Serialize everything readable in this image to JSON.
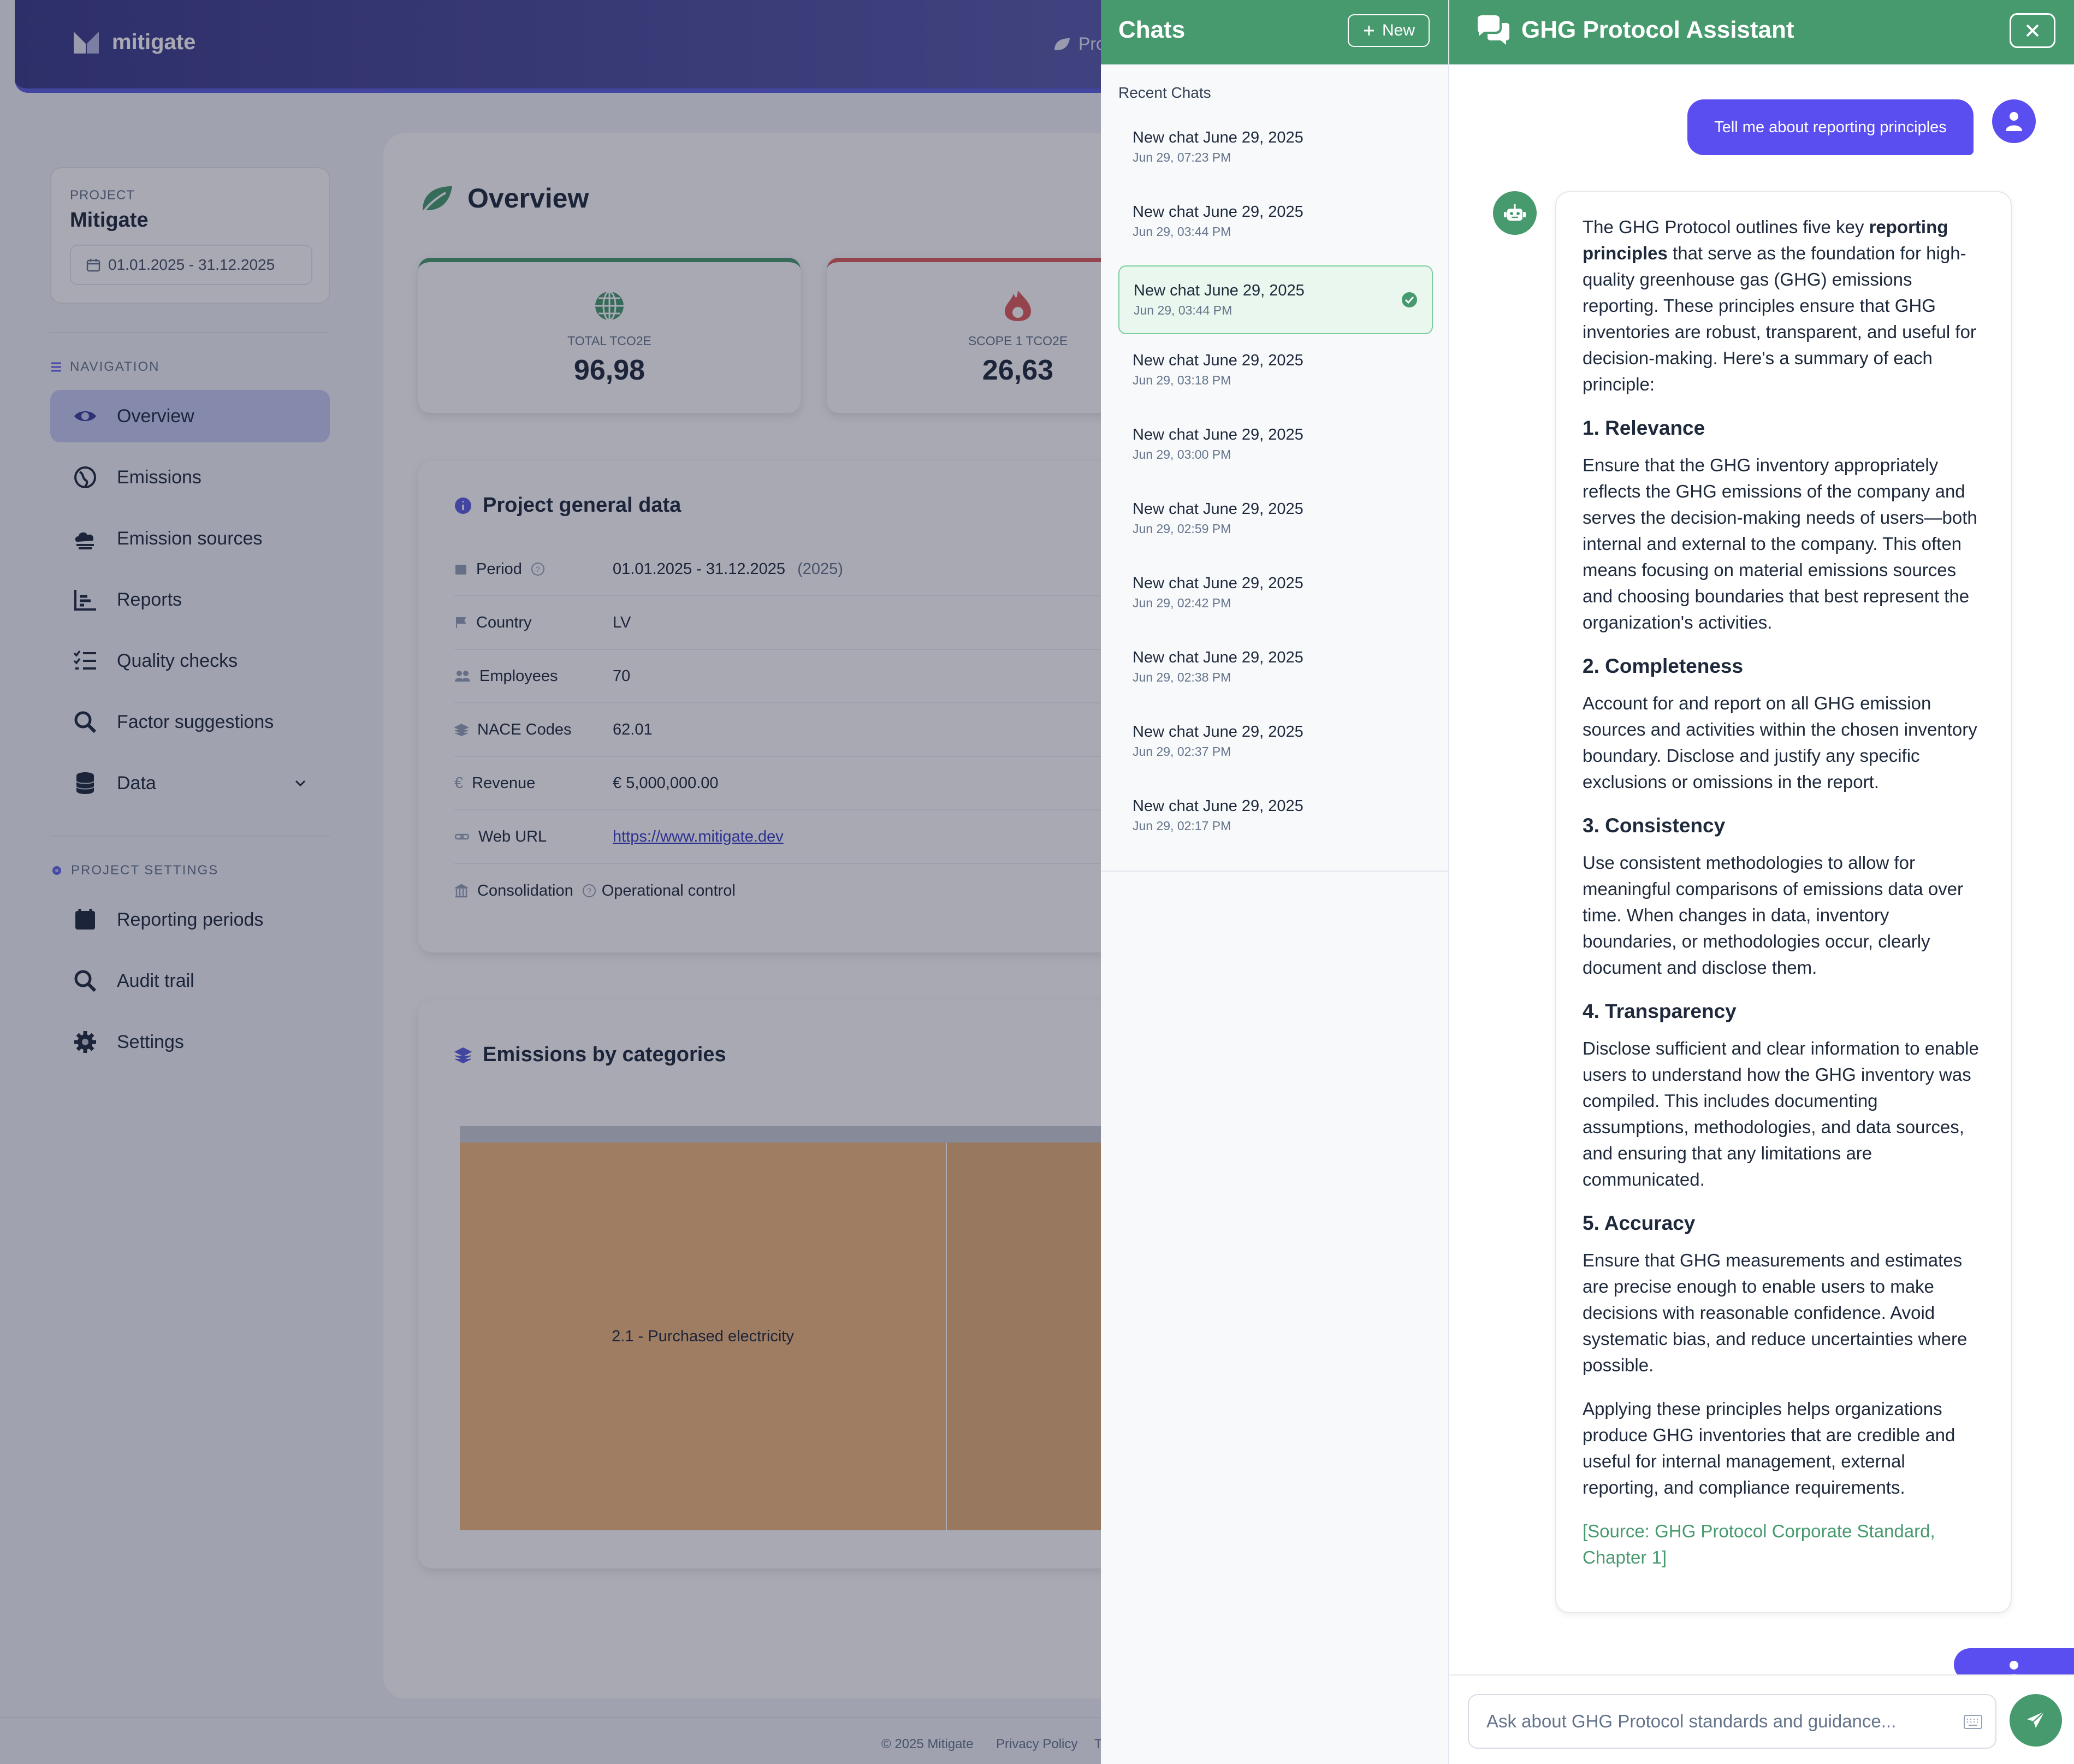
{
  "app": {
    "brand": "mitigate",
    "projects_link": "Proje"
  },
  "sidebar": {
    "project_label": "PROJECT",
    "project_name": "Mitigate",
    "project_period": "01.01.2025 - 31.12.2025",
    "nav_heading": "NAVIGATION",
    "items": [
      {
        "label": "Overview",
        "icon": "eye-icon"
      },
      {
        "label": "Emissions",
        "icon": "globe-icon"
      },
      {
        "label": "Emission sources",
        "icon": "cloud-icon"
      },
      {
        "label": "Reports",
        "icon": "chart-icon"
      },
      {
        "label": "Quality checks",
        "icon": "checklist-icon"
      },
      {
        "label": "Factor suggestions",
        "icon": "search-icon"
      },
      {
        "label": "Data",
        "icon": "database-icon"
      }
    ],
    "settings_heading": "PROJECT SETTINGS",
    "settings_items": [
      {
        "label": "Reporting periods",
        "icon": "calendar-icon"
      },
      {
        "label": "Audit trail",
        "icon": "search-icon"
      },
      {
        "label": "Settings",
        "icon": "gear-icon"
      }
    ]
  },
  "overview": {
    "title": "Overview",
    "stats": [
      {
        "label": "TOTAL TCO2E",
        "value": "96,98",
        "color": "#479a6e"
      },
      {
        "label": "SCOPE 1 TCO2E",
        "value": "26,63",
        "color": "#e05b5b"
      }
    ],
    "general": {
      "title": "Project general data",
      "rows": [
        {
          "key": "Period",
          "value": "01.01.2025 - 31.12.2025",
          "extra": "(2025)"
        },
        {
          "key": "Country",
          "value": "LV"
        },
        {
          "key": "Employees",
          "value": "70"
        },
        {
          "key": "NACE Codes",
          "value": "62.01"
        },
        {
          "key": "Revenue",
          "value": "€ 5,000,000.00"
        },
        {
          "key": "Web URL",
          "value": "https://www.mitigate.dev"
        },
        {
          "key": "Consolidation",
          "value": "Operational control"
        }
      ]
    },
    "categories": {
      "title": "Emissions by categories",
      "tile_label": "2.1 - Purchased electricity"
    }
  },
  "footer": {
    "copyright": "© 2025 Mitigate",
    "privacy": "Privacy Policy",
    "terms": "T"
  },
  "chats": {
    "title": "Chats",
    "new_label": "New",
    "recent_label": "Recent Chats",
    "items": [
      {
        "title": "New chat June 29, 2025",
        "date": "Jun 29, 07:23 PM"
      },
      {
        "title": "New chat June 29, 2025",
        "date": "Jun 29, 03:44 PM"
      },
      {
        "title": "New chat June 29, 2025",
        "date": "Jun 29, 03:44 PM"
      },
      {
        "title": "New chat June 29, 2025",
        "date": "Jun 29, 03:18 PM"
      },
      {
        "title": "New chat June 29, 2025",
        "date": "Jun 29, 03:00 PM"
      },
      {
        "title": "New chat June 29, 2025",
        "date": "Jun 29, 02:59 PM"
      },
      {
        "title": "New chat June 29, 2025",
        "date": "Jun 29, 02:42 PM"
      },
      {
        "title": "New chat June 29, 2025",
        "date": "Jun 29, 02:38 PM"
      },
      {
        "title": "New chat June 29, 2025",
        "date": "Jun 29, 02:37 PM"
      },
      {
        "title": "New chat June 29, 2025",
        "date": "Jun 29, 02:17 PM"
      }
    ]
  },
  "assistant": {
    "title": "GHG Protocol Assistant",
    "user_message": "Tell me about reporting principles",
    "reply": {
      "intro_pre": "The GHG Protocol outlines five key ",
      "intro_bold": "reporting principles",
      "intro_post": " that serve as the foundation for high-quality greenhouse gas (GHG) emissions reporting. These principles ensure that GHG inventories are robust, transparent, and useful for decision-making. Here's a summary of each principle:",
      "sections": [
        {
          "heading": "1. Relevance",
          "body": "Ensure that the GHG inventory appropriately reflects the GHG emissions of the company and serves the decision-making needs of users—both internal and external to the company. This often means focusing on material emissions sources and choosing boundaries that best represent the organization's activities."
        },
        {
          "heading": "2. Completeness",
          "body": "Account for and report on all GHG emission sources and activities within the chosen inventory boundary. Disclose and justify any specific exclusions or omissions in the report."
        },
        {
          "heading": "3. Consistency",
          "body": "Use consistent methodologies to allow for meaningful comparisons of emissions data over time. When changes in data, inventory boundaries, or methodologies occur, clearly document and disclose them."
        },
        {
          "heading": "4. Transparency",
          "body": "Disclose sufficient and clear information to enable users to understand how the GHG inventory was compiled. This includes documenting assumptions, methodologies, and data sources, and ensuring that any limitations are communicated."
        },
        {
          "heading": "5. Accuracy",
          "body": "Ensure that GHG measurements and estimates are precise enough to enable users to make decisions with reasonable confidence. Avoid systematic bias, and reduce uncertainties where possible."
        }
      ],
      "closing": "Applying these principles helps organizations produce GHG inventories that are credible and useful for internal management, external reporting, and compliance requirements.",
      "source": "[Source: GHG Protocol Corporate Standard, Chapter 1]"
    },
    "input_placeholder": "Ask about GHG Protocol standards and guidance..."
  }
}
